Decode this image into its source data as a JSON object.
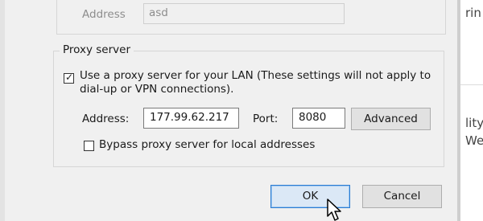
{
  "background_window": {
    "lines": [
      "rin",
      "lity",
      "We"
    ]
  },
  "dialup": {
    "address_label": "Address",
    "address_value": "asd"
  },
  "proxy": {
    "group_title": "Proxy server",
    "use_proxy_checked": true,
    "use_proxy_label_line1": "Use a proxy server for your LAN (These settings will not apply to",
    "use_proxy_label_line2": "dial-up or VPN connections).",
    "address_label": "Address:",
    "address_value": "177.99.62.217",
    "port_label": "Port:",
    "port_value": "8080",
    "advanced_label": "Advanced",
    "bypass_checked": false,
    "bypass_label": "Bypass proxy server for local addresses"
  },
  "buttons": {
    "ok_label": "OK",
    "cancel_label": "Cancel"
  },
  "colors": {
    "accent": "#2b7cd3"
  }
}
